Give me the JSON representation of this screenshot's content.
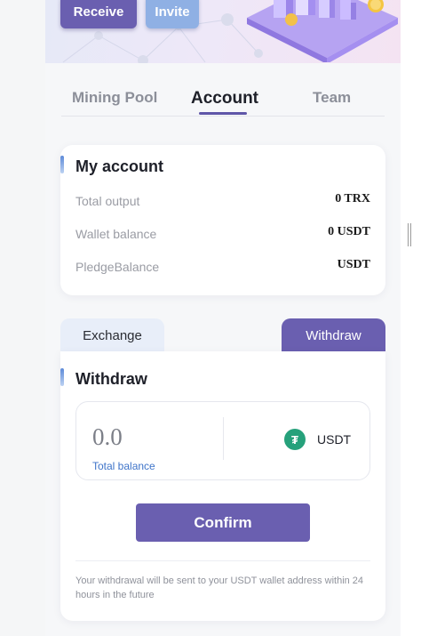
{
  "banner": {
    "receive_label": "Receive",
    "invite_label": "Invite"
  },
  "tabs": [
    {
      "label": "Mining Pool",
      "active": false
    },
    {
      "label": "Account",
      "active": true
    },
    {
      "label": "Team",
      "active": false
    }
  ],
  "account": {
    "title": "My account",
    "rows": [
      {
        "label": "Total output",
        "value": "0 TRX"
      },
      {
        "label": "Wallet balance",
        "value": "0 USDT"
      },
      {
        "label": "PledgeBalance",
        "value": "USDT"
      }
    ]
  },
  "segments": {
    "exchange_label": "Exchange",
    "withdraw_label": "Withdraw",
    "active": "Withdraw"
  },
  "withdraw": {
    "title": "Withdraw",
    "amount_value": "0.0",
    "total_balance_label": "Total balance",
    "currency": "USDT",
    "currency_icon": "tether-icon",
    "confirm_label": "Confirm",
    "note": "Your withdrawal will be sent to your USDT wallet address within 24 hours in the future"
  },
  "colors": {
    "primary": "#6a5fb0",
    "secondary": "#8fb0e4",
    "link": "#3f74c9",
    "tether": "#26a17b"
  }
}
